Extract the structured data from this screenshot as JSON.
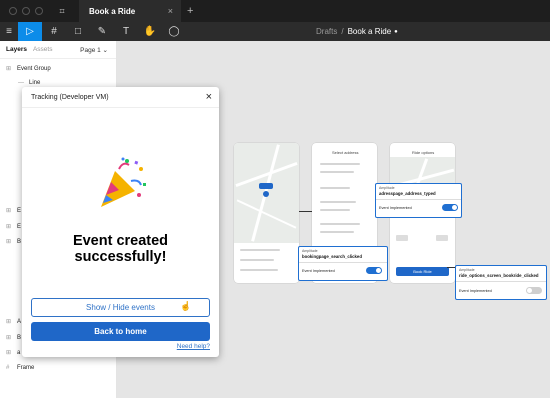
{
  "window": {
    "tab_title": "Book a Ride",
    "tab_close": "×",
    "tab_add": "+",
    "figma_logo": "⌗"
  },
  "toolbar": {
    "menu_icon": "≡",
    "move_icon": "▷",
    "frame_icon": "#",
    "shape_icon": "□",
    "pen_icon": "✎",
    "text_icon": "T",
    "hand_icon": "✋",
    "comment_icon": "◯",
    "breadcrumb": {
      "drafts": "Drafts",
      "separator": "/",
      "file": "Book a Ride",
      "unsaved_dot": "●"
    }
  },
  "layers_panel": {
    "tab_layers": "Layers",
    "tab_assets": "Assets",
    "page_selector": "Page 1 ⌄",
    "items": [
      {
        "label": "Event Group",
        "icon": "⊞"
      },
      {
        "label": "Line",
        "icon": "—"
      },
      {
        "label": "E",
        "icon": "⊞"
      },
      {
        "label": "E",
        "icon": "⊞"
      },
      {
        "label": "B",
        "icon": "⊞"
      },
      {
        "label": "A",
        "icon": "⊞"
      },
      {
        "label": "B",
        "icon": "⊞"
      },
      {
        "label": "a",
        "icon": "⊞"
      },
      {
        "label": "Frame",
        "icon": "#"
      }
    ]
  },
  "modal": {
    "title": "Tracking (Developer VM)",
    "close_icon": "×",
    "illustration": "party-popper",
    "success_line1": "Event created",
    "success_line2": "successfully!",
    "show_hide_button": "Show / Hide events",
    "back_home_button": "Back to home",
    "help_link": "Need help?"
  },
  "canvas": {
    "screen_select_address_title": "Select address",
    "screen_ride_options_title": "Ride options",
    "book_ride_button": "Book Ride",
    "event_cards": [
      {
        "source": "Amplitude",
        "name": "adresspage_address_typed",
        "implemented_label": "Event Implemented",
        "implemented": true
      },
      {
        "source": "Amplitude",
        "name": "bookingpage_search_clicked",
        "implemented_label": "Event Implemented",
        "implemented": true
      },
      {
        "source": "Amplitude",
        "name": "ride_options_screen_bookride_clicked",
        "implemented_label": "Event Implemented",
        "implemented": false
      }
    ]
  },
  "colors": {
    "accent": "#0c8ce9",
    "primary_button": "#1f67c8",
    "event_card_border": "#1f6fd1"
  }
}
